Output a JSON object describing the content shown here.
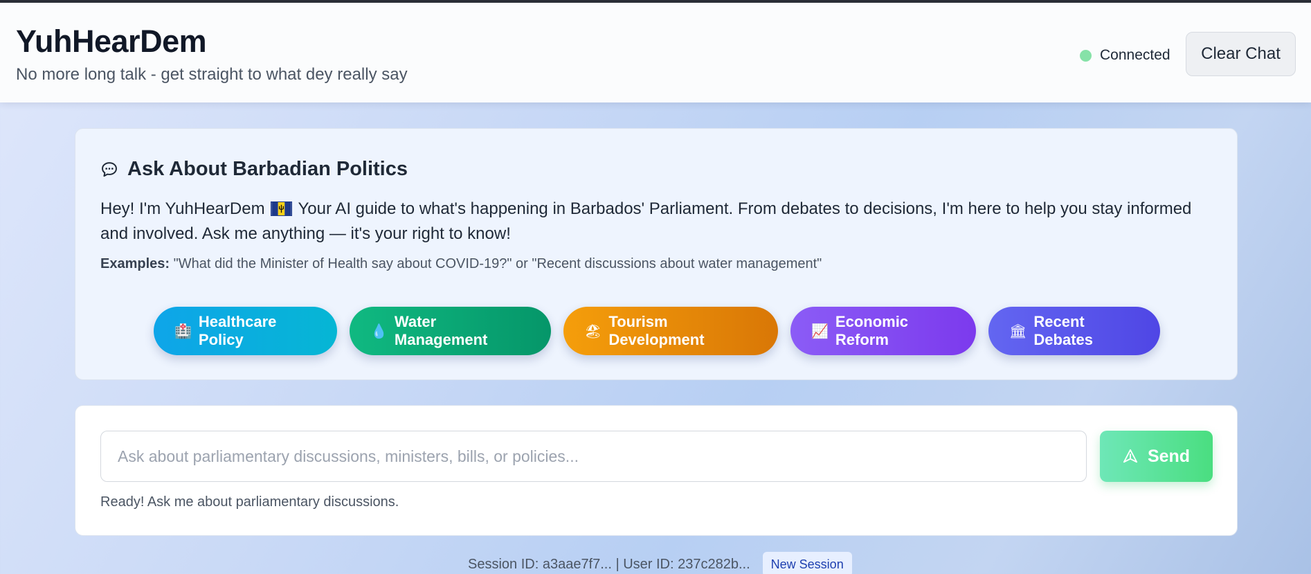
{
  "header": {
    "title": "YuhHearDem",
    "subtitle": "No more long talk - get straight to what dey really say",
    "status_text": "Connected",
    "status_color": "#86e2a8",
    "clear_label": "Clear Chat"
  },
  "intro": {
    "icon": "chat-bubble-icon",
    "title": "Ask About Barbadian Politics",
    "text_before_flag": "Hey! I'm YuhHearDem",
    "flag_icon": "barbados-flag-icon",
    "text_after_flag": "Your AI guide to what's happening in Barbados' Parliament. From debates to decisions, I'm here to help you stay informed and involved. Ask me anything — it's your right to know!",
    "examples_label": "Examples:",
    "examples_text": "\"What did the Minister of Health say about COVID-19?\" or \"Recent discussions about water management\""
  },
  "topics": [
    {
      "icon": "hospital-icon",
      "glyph": "🏥",
      "label": "Healthcare Policy",
      "color": "#0ea5e9"
    },
    {
      "icon": "water-drop-icon",
      "glyph": "💧",
      "label": "Water Management",
      "color": "#10b981"
    },
    {
      "icon": "beach-umbrella-icon",
      "glyph": "🏖",
      "label": "Tourism Development",
      "color": "#f59e0b"
    },
    {
      "icon": "chart-up-icon",
      "glyph": "📈",
      "label": "Economic Reform",
      "color": "#8b5cf6"
    },
    {
      "icon": "government-building-icon",
      "glyph": "🏛",
      "label": "Recent Debates",
      "color": "#6366f1"
    }
  ],
  "composer": {
    "placeholder": "Ask about parliamentary discussions, ministers, bills, or policies...",
    "value": "",
    "send_icon": "send-icon",
    "send_label": "Send",
    "status": "Ready! Ask me about parliamentary discussions."
  },
  "footer": {
    "session_text": "Session ID: a3aae7f7... | User ID: 237c282b...",
    "new_session_label": "New Session"
  }
}
